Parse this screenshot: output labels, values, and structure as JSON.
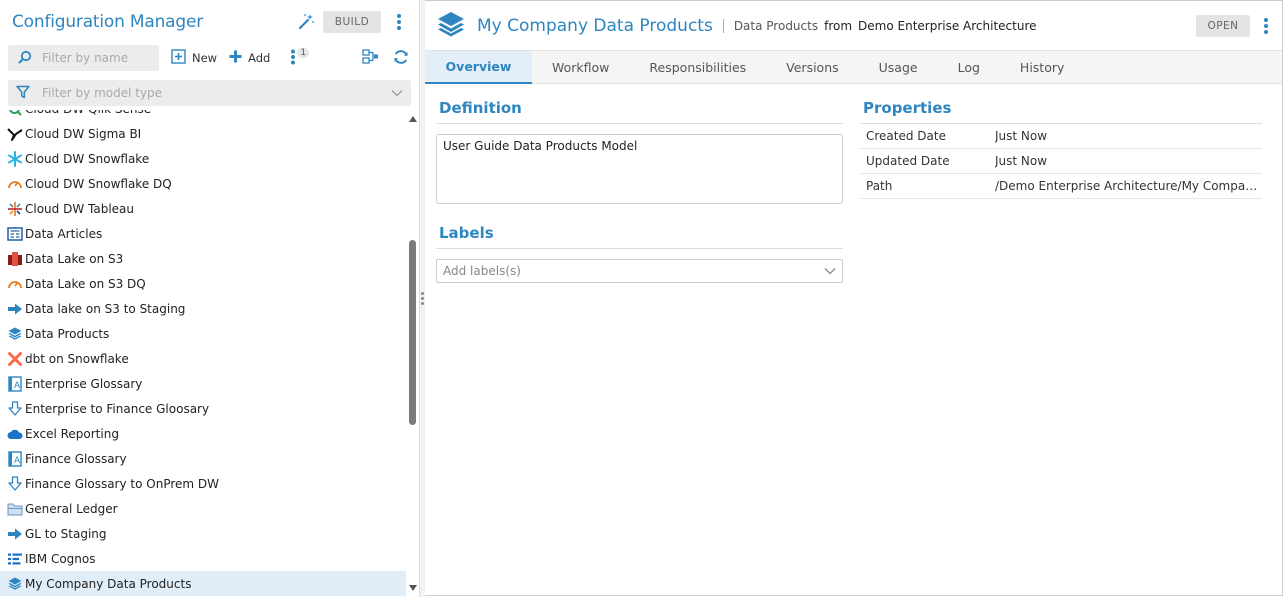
{
  "left_panel": {
    "title": "Configuration Manager",
    "build_label": "BUILD",
    "filter_name_placeholder": "Filter by name",
    "new_label": "New",
    "add_label": "Add",
    "badge_count": "1",
    "filter_type_placeholder": "Filter by model type"
  },
  "tree_items": [
    {
      "label": "Cloud DW Qlik Sense",
      "icon": "qlik-icon"
    },
    {
      "label": "Cloud DW Sigma BI",
      "icon": "sigma-icon"
    },
    {
      "label": "Cloud DW Snowflake",
      "icon": "snowflake-icon"
    },
    {
      "label": "Cloud DW Snowflake DQ",
      "icon": "data-quality-gauge-icon"
    },
    {
      "label": "Cloud DW Tableau",
      "icon": "tableau-icon"
    },
    {
      "label": "Data Articles",
      "icon": "article-icon"
    },
    {
      "label": "Data Lake on S3",
      "icon": "s3-bucket-icon"
    },
    {
      "label": "Data Lake on S3 DQ",
      "icon": "data-quality-gauge-icon"
    },
    {
      "label": "Data lake on S3 to Staging",
      "icon": "mapping-arrow-icon"
    },
    {
      "label": "Data Products",
      "icon": "layers-icon"
    },
    {
      "label": "dbt on Snowflake",
      "icon": "dbt-icon"
    },
    {
      "label": "Enterprise Glossary",
      "icon": "glossary-icon"
    },
    {
      "label": "Enterprise to Finance Gloosary",
      "icon": "import-arrow-icon"
    },
    {
      "label": "Excel Reporting",
      "icon": "cloud-icon"
    },
    {
      "label": "Finance Glossary",
      "icon": "glossary-icon"
    },
    {
      "label": "Finance Glossary to OnPrem DW",
      "icon": "import-arrow-icon"
    },
    {
      "label": "General Ledger",
      "icon": "folder-icon"
    },
    {
      "label": "GL to Staging",
      "icon": "mapping-arrow-icon"
    },
    {
      "label": "IBM Cognos",
      "icon": "cognos-icon"
    },
    {
      "label": "My Company Data Products",
      "icon": "layers-icon",
      "selected": true
    }
  ],
  "right_panel": {
    "title": "My Company Data Products",
    "crumb_type": "Data Products",
    "crumb_from": "from",
    "crumb_architecture": "Demo Enterprise Architecture",
    "open_label": "OPEN",
    "tabs": [
      "Overview",
      "Workflow",
      "Responsibilities",
      "Versions",
      "Usage",
      "Log",
      "History"
    ],
    "active_tab": "Overview",
    "definition_title": "Definition",
    "definition_text": "User Guide Data Products Model",
    "labels_title": "Labels",
    "labels_placeholder": "Add labels(s)",
    "properties_title": "Properties",
    "properties": [
      {
        "key": "Created Date",
        "value": "Just Now"
      },
      {
        "key": "Updated Date",
        "value": "Just Now"
      },
      {
        "key": "Path",
        "value": "/Demo Enterprise Architecture/My Company..."
      }
    ]
  },
  "colors": {
    "accent": "#2e86c1",
    "selected_row": "#e1eef8",
    "button_gray": "#e4e4e4"
  }
}
